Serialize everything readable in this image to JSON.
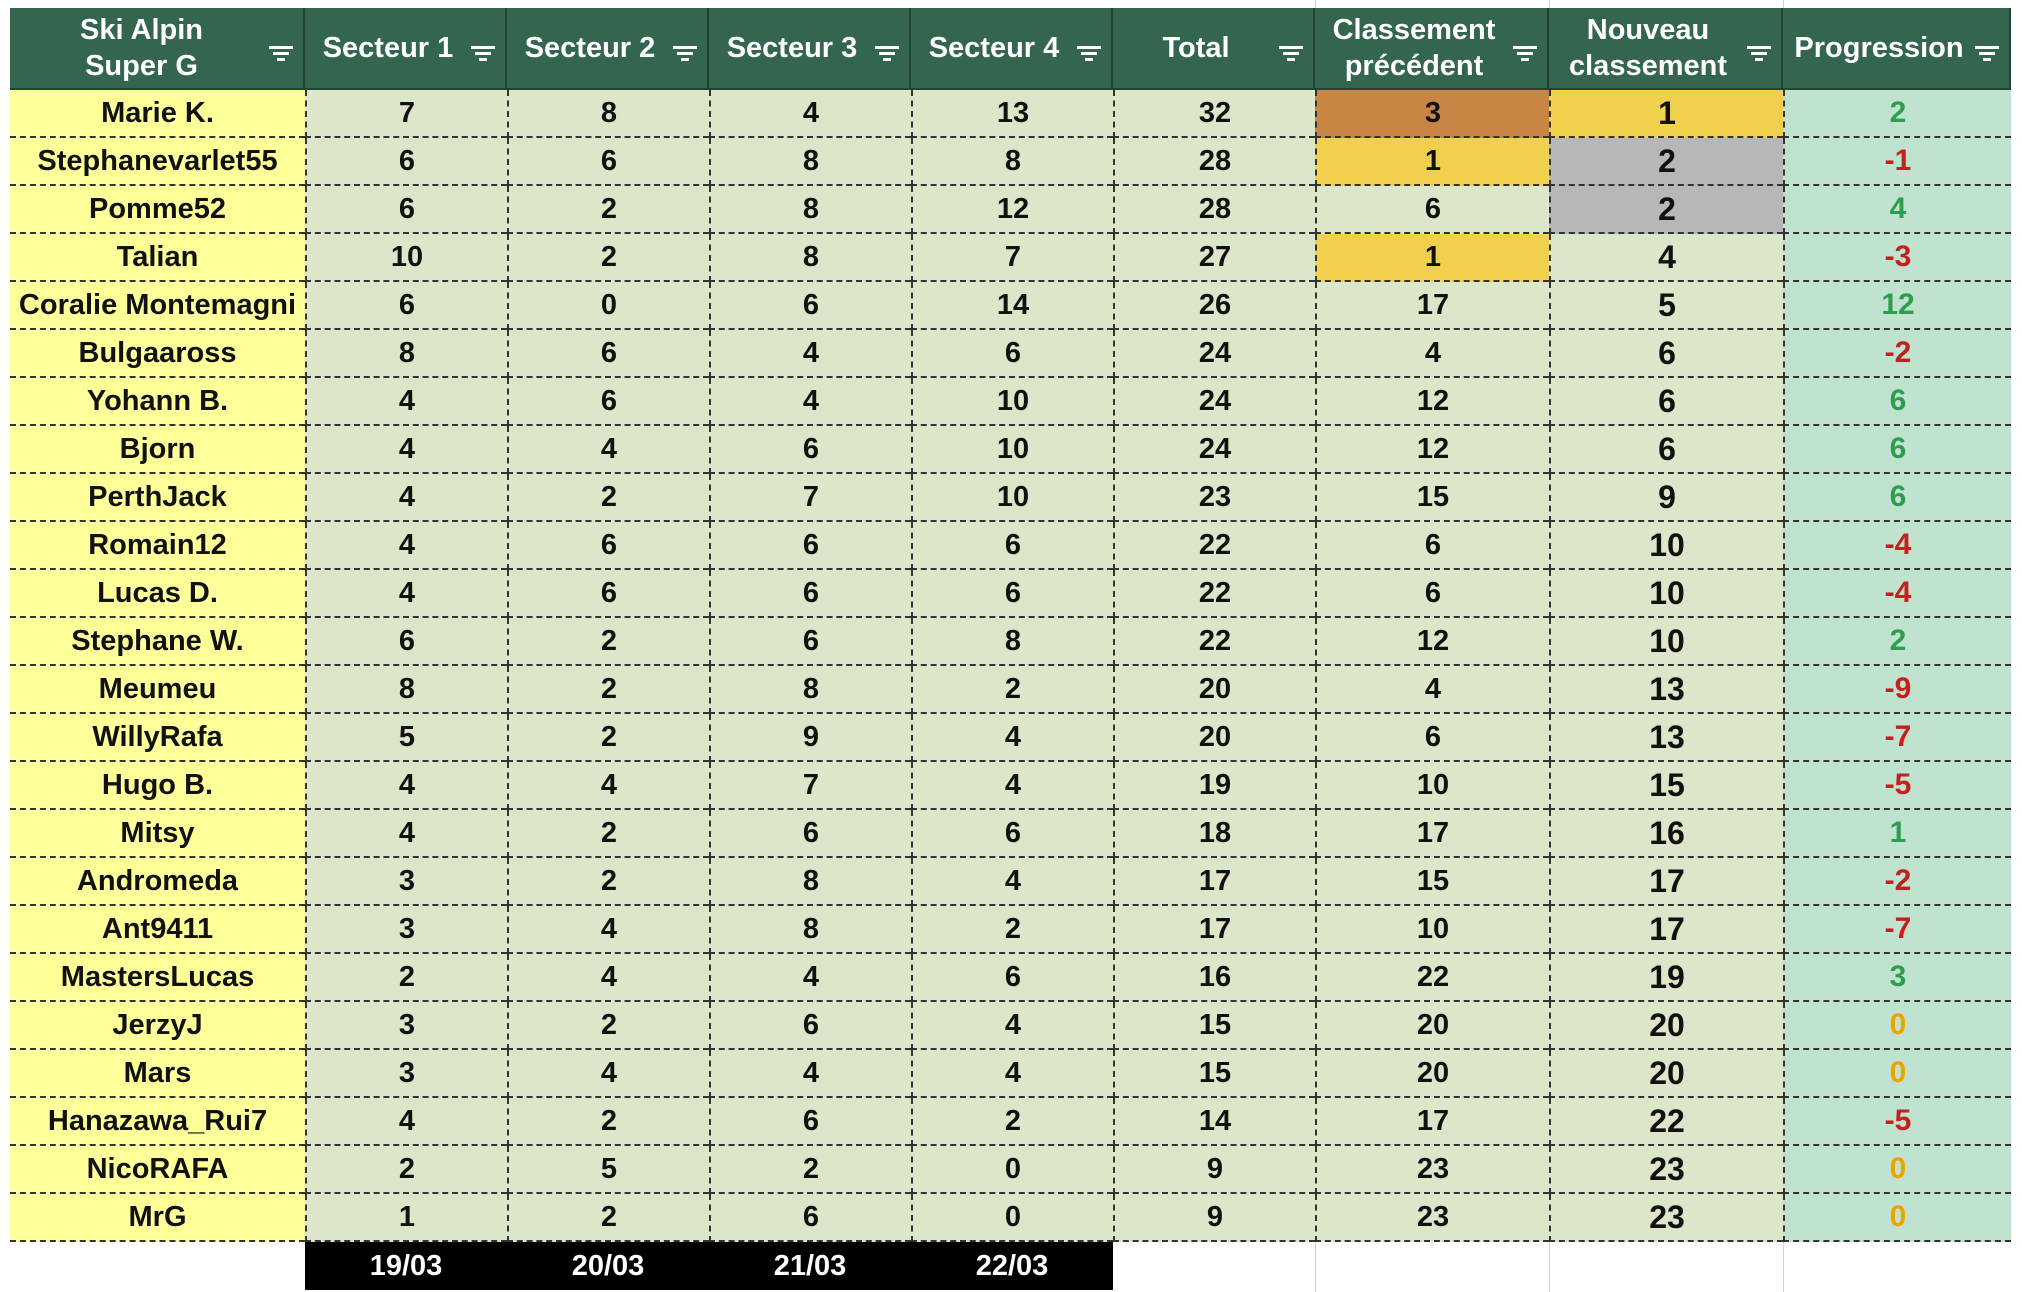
{
  "header": {
    "event_line1": "Ski Alpin",
    "event_line2": "Super G",
    "s1": "Secteur 1",
    "s2": "Secteur 2",
    "s3": "Secteur 3",
    "s4": "Secteur 4",
    "total": "Total",
    "prev_line1": "Classement",
    "prev_line2": "précédent",
    "new_line1": "Nouveau",
    "new_line2": "classement",
    "progress": "Progression"
  },
  "rows": [
    {
      "name": "Marie K.",
      "s1": "7",
      "s2": "8",
      "s3": "4",
      "s4": "13",
      "total": "32",
      "prev": "3",
      "rank": "1",
      "prog": "2"
    },
    {
      "name": "Stephanevarlet55",
      "s1": "6",
      "s2": "6",
      "s3": "8",
      "s4": "8",
      "total": "28",
      "prev": "1",
      "rank": "2",
      "prog": "-1"
    },
    {
      "name": "Pomme52",
      "s1": "6",
      "s2": "2",
      "s3": "8",
      "s4": "12",
      "total": "28",
      "prev": "6",
      "rank": "2",
      "prog": "4"
    },
    {
      "name": "Talian",
      "s1": "10",
      "s2": "2",
      "s3": "8",
      "s4": "7",
      "total": "27",
      "prev": "1",
      "rank": "4",
      "prog": "-3"
    },
    {
      "name": "Coralie Montemagni",
      "s1": "6",
      "s2": "0",
      "s3": "6",
      "s4": "14",
      "total": "26",
      "prev": "17",
      "rank": "5",
      "prog": "12"
    },
    {
      "name": "Bulgaaross",
      "s1": "8",
      "s2": "6",
      "s3": "4",
      "s4": "6",
      "total": "24",
      "prev": "4",
      "rank": "6",
      "prog": "-2"
    },
    {
      "name": "Yohann B.",
      "s1": "4",
      "s2": "6",
      "s3": "4",
      "s4": "10",
      "total": "24",
      "prev": "12",
      "rank": "6",
      "prog": "6"
    },
    {
      "name": "Bjorn",
      "s1": "4",
      "s2": "4",
      "s3": "6",
      "s4": "10",
      "total": "24",
      "prev": "12",
      "rank": "6",
      "prog": "6"
    },
    {
      "name": "PerthJack",
      "s1": "4",
      "s2": "2",
      "s3": "7",
      "s4": "10",
      "total": "23",
      "prev": "15",
      "rank": "9",
      "prog": "6"
    },
    {
      "name": "Romain12",
      "s1": "4",
      "s2": "6",
      "s3": "6",
      "s4": "6",
      "total": "22",
      "prev": "6",
      "rank": "10",
      "prog": "-4"
    },
    {
      "name": "Lucas D.",
      "s1": "4",
      "s2": "6",
      "s3": "6",
      "s4": "6",
      "total": "22",
      "prev": "6",
      "rank": "10",
      "prog": "-4"
    },
    {
      "name": "Stephane W.",
      "s1": "6",
      "s2": "2",
      "s3": "6",
      "s4": "8",
      "total": "22",
      "prev": "12",
      "rank": "10",
      "prog": "2"
    },
    {
      "name": "Meumeu",
      "s1": "8",
      "s2": "2",
      "s3": "8",
      "s4": "2",
      "total": "20",
      "prev": "4",
      "rank": "13",
      "prog": "-9"
    },
    {
      "name": "WillyRafa",
      "s1": "5",
      "s2": "2",
      "s3": "9",
      "s4": "4",
      "total": "20",
      "prev": "6",
      "rank": "13",
      "prog": "-7"
    },
    {
      "name": "Hugo B.",
      "s1": "4",
      "s2": "4",
      "s3": "7",
      "s4": "4",
      "total": "19",
      "prev": "10",
      "rank": "15",
      "prog": "-5"
    },
    {
      "name": "Mitsy",
      "s1": "4",
      "s2": "2",
      "s3": "6",
      "s4": "6",
      "total": "18",
      "prev": "17",
      "rank": "16",
      "prog": "1"
    },
    {
      "name": "Andromeda",
      "s1": "3",
      "s2": "2",
      "s3": "8",
      "s4": "4",
      "total": "17",
      "prev": "15",
      "rank": "17",
      "prog": "-2"
    },
    {
      "name": "Ant9411",
      "s1": "3",
      "s2": "4",
      "s3": "8",
      "s4": "2",
      "total": "17",
      "prev": "10",
      "rank": "17",
      "prog": "-7"
    },
    {
      "name": "MastersLucas",
      "s1": "2",
      "s2": "4",
      "s3": "4",
      "s4": "6",
      "total": "16",
      "prev": "22",
      "rank": "19",
      "prog": "3"
    },
    {
      "name": "JerzyJ",
      "s1": "3",
      "s2": "2",
      "s3": "6",
      "s4": "4",
      "total": "15",
      "prev": "20",
      "rank": "20",
      "prog": "0"
    },
    {
      "name": "Mars",
      "s1": "3",
      "s2": "4",
      "s3": "4",
      "s4": "4",
      "total": "15",
      "prev": "20",
      "rank": "20",
      "prog": "0"
    },
    {
      "name": "Hanazawa_Rui7",
      "s1": "4",
      "s2": "2",
      "s3": "6",
      "s4": "2",
      "total": "14",
      "prev": "17",
      "rank": "22",
      "prog": "-5"
    },
    {
      "name": "NicoRAFA",
      "s1": "2",
      "s2": "5",
      "s3": "2",
      "s4": "0",
      "total": "9",
      "prev": "23",
      "rank": "23",
      "prog": "0"
    },
    {
      "name": "MrG",
      "s1": "1",
      "s2": "2",
      "s3": "6",
      "s4": "0",
      "total": "9",
      "prev": "23",
      "rank": "23",
      "prog": "0"
    }
  ],
  "dates": [
    "19/03",
    "20/03",
    "21/03",
    "22/03"
  ],
  "colors": {
    "header_bg": "#33654f",
    "name_bg": "#ffff99",
    "cell_bg": "#dce6c8",
    "progress_bg": "#bfe3cf",
    "gold": "#f0d04c",
    "silver": "#b7b7b7",
    "bronze": "#c98543",
    "positive": "#2e9e4e",
    "negative": "#c6201b",
    "zero": "#f0a100"
  },
  "icons": {
    "filter": "filter-icon"
  }
}
